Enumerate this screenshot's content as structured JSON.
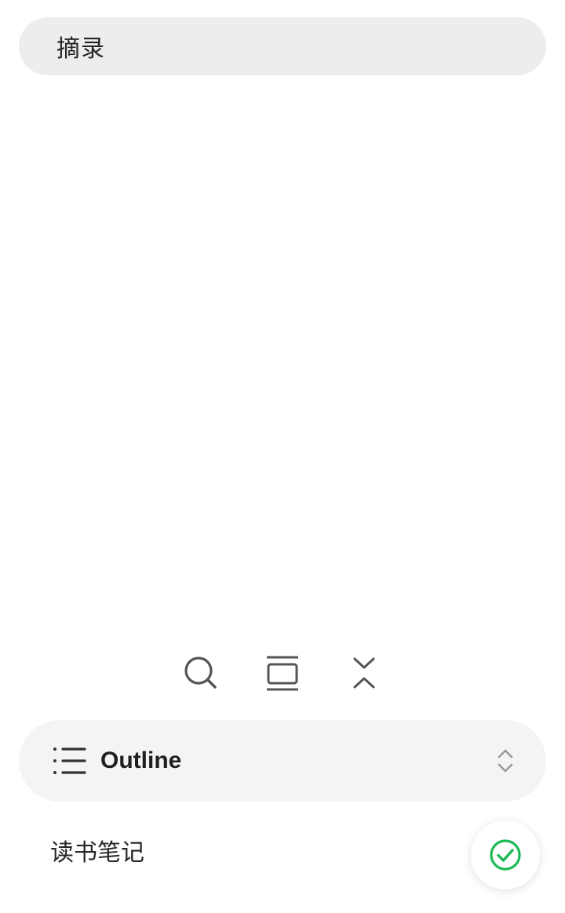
{
  "search": {
    "text": "摘录"
  },
  "toolbar": {
    "items": [
      {
        "icon": "search-icon"
      },
      {
        "icon": "cards-icon"
      },
      {
        "icon": "collapse-icon"
      }
    ]
  },
  "outline": {
    "icon": "list-icon",
    "label": "Outline",
    "sort_icon": "sort-updown-icon"
  },
  "notes": {
    "item_label": "读书笔记"
  },
  "fab": {
    "icon": "check-circle-icon",
    "color": "#1db954"
  },
  "colors": {
    "pill_bg": "#ededed",
    "outline_bg": "#f4f4f4",
    "icon_gray": "#555555",
    "check_green": "#1db954"
  }
}
